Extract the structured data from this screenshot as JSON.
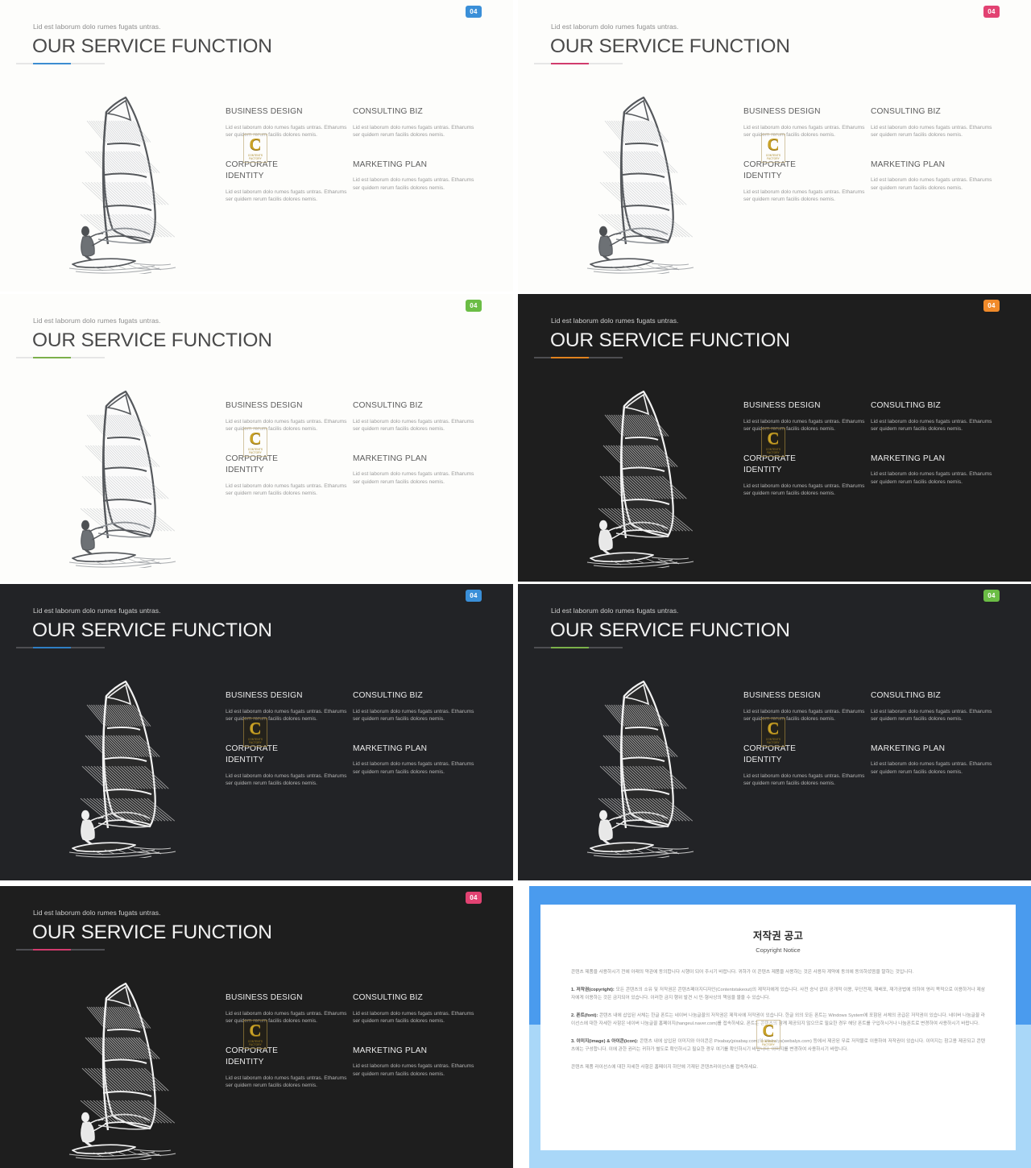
{
  "slide": {
    "eyebrow": "Lid est laborum dolo rumes fugats untras.",
    "title": "OUR SERVICE FUNCTION",
    "badge": "04",
    "body": "Lid est laborum dolo rumes fugats untras. Etharums ser quidem rerum facilis dolores nemis.",
    "features": [
      {
        "heading": "BUSINESS DESIGN",
        "body": "Lid est laborum dolo rumes fugats untras. Etharums ser quidem rerum facilis dolores nemis."
      },
      {
        "heading": "CONSULTING BIZ",
        "body": "Lid est laborum dolo rumes fugats untras. Etharums ser quidem rerum facilis dolores nemis."
      },
      {
        "heading": "CORPORATE\nIDENTITY",
        "body": "Lid est laborum dolo rumes fugats untras. Etharums ser quidem rerum facilis dolores nemis."
      },
      {
        "heading": "MARKETING PLAN",
        "body": "Lid est laborum dolo rumes fugats untras. Etharums ser quidem rerum facilis dolores nemis."
      }
    ],
    "illustration": "windsurfer-sketch"
  },
  "watermark": {
    "letter": "C",
    "tag_line1": "CONTENTS",
    "tag_line2": "FACTORY"
  },
  "panels": [
    {
      "id": "panel-1",
      "theme": "light",
      "accent": "#3c8dd1",
      "badge_color": "#3a8fd8",
      "badge": "04"
    },
    {
      "id": "panel-2",
      "theme": "light",
      "accent": "#d13b6d",
      "badge_color": "#e24272",
      "badge": "04"
    },
    {
      "id": "panel-3",
      "theme": "light",
      "accent": "#7bb04a",
      "badge_color": "#6bbd45",
      "badge": "04"
    },
    {
      "id": "panel-4",
      "theme": "dark",
      "accent": "#e0821f",
      "badge_color": "#f08a2a",
      "badge": "04"
    },
    {
      "id": "panel-5",
      "theme": "dark2",
      "accent": "#2f7fc4",
      "badge_color": "#3a8fd8",
      "badge": "04"
    },
    {
      "id": "panel-6",
      "theme": "dark2",
      "accent": "#7bb04a",
      "badge_color": "#6bbd45",
      "badge": "04"
    },
    {
      "id": "panel-7",
      "theme": "dark",
      "accent": "#d13b6d",
      "badge_color": "#e24272",
      "badge": "04"
    }
  ],
  "copyright": {
    "title": "저작권 공고",
    "subtitle": "Copyright Notice",
    "intro": "콘텐츠 제품을 사용하시기 전에 아래의 약관에 동의합니다 시행이 되어 주시기 바랍니다. 귀하가 이 콘텐츠 제품을 사용하는 것은 사용자 계약에 동의에 동의하셨음을 말하는 것입니다.",
    "section1_label": "1. 저작권(copyright):",
    "section1": " 모든 콘텐츠의 소유 및 저작권은 콘텐츠페이지디자인(Contentstakeout)의 제작자에게 있습니다. 사전 승낙 없이 공개적 이용, 무단전재, 재배포, 재가공법에 의하여 영리 목적으로 이용하거나 제삼자에게 이용하는 것은 금지되어 있습니다. 이러한 금지 행위 발견 시 민·형사상의 책임을 물을 수 있습니다.",
    "section2_label": "2. 폰트(font):",
    "section2": " 콘텐츠 내에 삽입된 서체는 한글 폰트는 네이버 나눔글꼴의 저작권은 제작사에 저작권이 있습니다. 한글 외의 모든 폰트는 Windows System에 포함된 서체의 공급은 저작권이 있습니다. 네이버 나눔글꼴 라이선스에 대한 자세한 사항은 네이버 나눔글꼴 홈페이지(hangeul.naver.com)를 접속하세요. 폰트는 콘텐츠의 함께 제공되지 않으므로 필요한 경우 해당 폰트를 구입하시거나 나눔폰트로 변경하여 사용하시기 바랍니다.",
    "section3_label": "3. 이미지(image) & 아이콘(icon):",
    "section3": " 콘텐츠 내에 삽입된 이미지와 아이콘은 Pixabay(pixabay.com)와 Webalys(webalys.com) 등에서 제공된 무료 저작물로 이용하여 저작권이 있습니다. 이미지는 참고용 제공되고 콘텐츠에는 구성합니다. 이에 관한 권리는 귀하가 별도로 확인하시고 필요한 경우 여기를 확인하시기 바랍니다. 이미지를 변경하여 사용하시기 바랍니다.",
    "footer": "콘텐츠 제품 라이선스에 대한 자세한 사항은 홈페이지 하단에 기재된 콘텐츠라이선스를 접속하세요."
  }
}
